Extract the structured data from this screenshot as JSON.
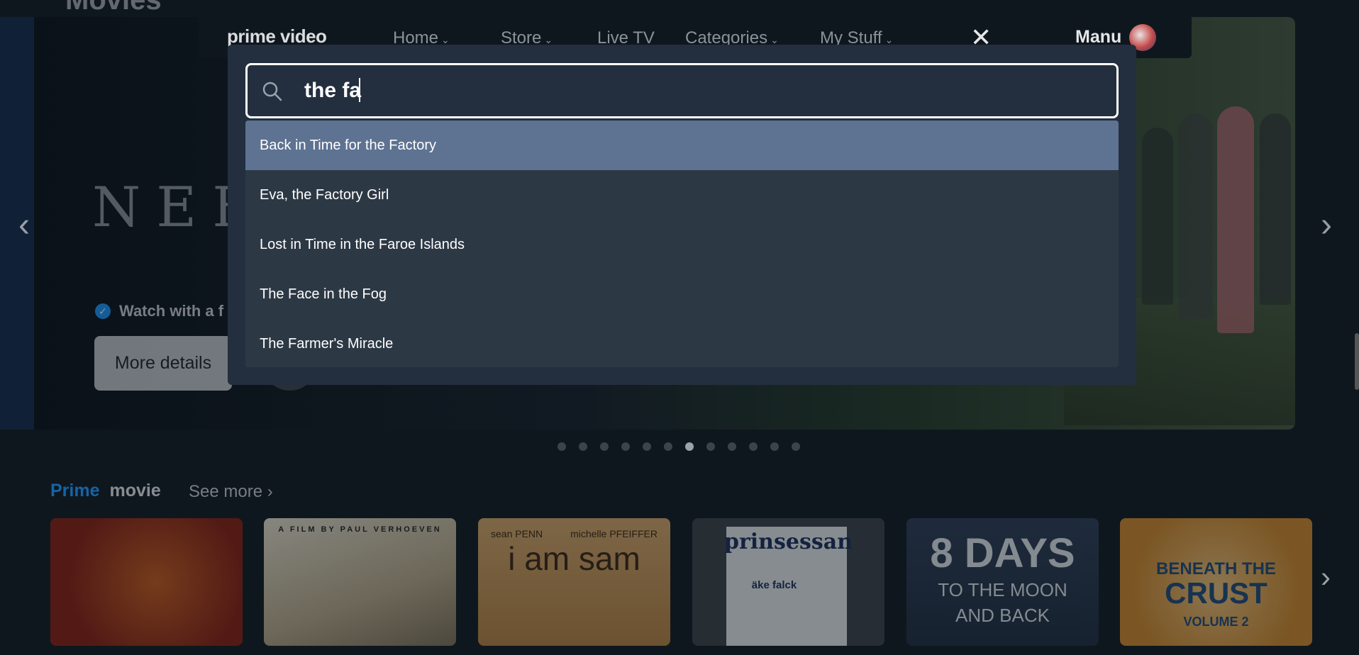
{
  "page": {
    "title": "Movies"
  },
  "hero": {
    "title_art": "NEEY",
    "watch_label": "Watch with a f",
    "more_details_label": "More details",
    "prev_arrow": "‹",
    "next_arrow": "›",
    "dot_count": 12,
    "active_dot": 7
  },
  "navbar": {
    "brand": "prime video",
    "items": [
      {
        "label": "Home",
        "has_dropdown": true
      },
      {
        "label": "Store",
        "has_dropdown": true
      },
      {
        "label": "Live TV",
        "has_dropdown": false
      },
      {
        "label": "Categories",
        "has_dropdown": true
      },
      {
        "label": "My Stuff",
        "has_dropdown": true
      }
    ],
    "close_glyph": "✕",
    "user_name": "Manu"
  },
  "search": {
    "value": "the fa",
    "suggestions": [
      {
        "label": "Back in Time for the Factory",
        "highlighted": true
      },
      {
        "label": "Eva, the Factory Girl",
        "highlighted": false
      },
      {
        "label": "Lost in Time in the Faroe Islands",
        "highlighted": false
      },
      {
        "label": "The Face in the Fog",
        "highlighted": false
      },
      {
        "label": "The Farmer's Miracle",
        "highlighted": false
      }
    ]
  },
  "row": {
    "prime_label": "Prime",
    "movie_label": "movie",
    "see_more_label": "See more",
    "see_more_chevron": "›",
    "next_arrow": "›",
    "tiles": [
      {
        "name": "tile-red-art",
        "lines": []
      },
      {
        "name": "tile-verhoeven",
        "lines": [
          "A FILM BY PAUL VERHOEVEN"
        ]
      },
      {
        "name": "tile-i-am-sam",
        "lines": [
          "sean PENN",
          "michelle PFEIFFER",
          "i am sam"
        ]
      },
      {
        "name": "tile-prinsessan",
        "lines": [
          "prinsessan",
          "äke falck"
        ]
      },
      {
        "name": "tile-8-days",
        "lines": [
          "8 DAYS",
          "TO THE MOON",
          "AND BACK"
        ]
      },
      {
        "name": "tile-beneath-the-crust",
        "lines": [
          "BENEATH THE",
          "CRUST",
          "VOLUME 2"
        ]
      }
    ]
  },
  "colors": {
    "background": "#0f171e",
    "panel": "#232f3e",
    "highlight": "#5e7291",
    "prime_blue": "#1a98ff"
  }
}
